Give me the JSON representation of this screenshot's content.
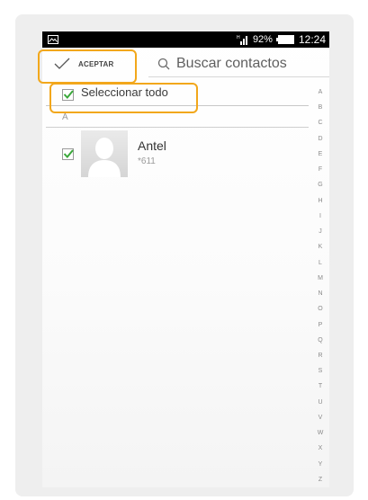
{
  "status_bar": {
    "battery_percent": "92%",
    "time": "12:24"
  },
  "action_bar": {
    "accept_label": "ACEPTAR",
    "search_placeholder": "Buscar contactos"
  },
  "select_all": {
    "label": "Seleccionar todo",
    "checked": true
  },
  "sections": [
    {
      "header": "A",
      "contacts": [
        {
          "name": "Antel",
          "number": "*611",
          "checked": true
        }
      ]
    }
  ],
  "alphabet_index": [
    "A",
    "B",
    "C",
    "D",
    "E",
    "F",
    "G",
    "H",
    "I",
    "J",
    "K",
    "L",
    "M",
    "N",
    "O",
    "P",
    "Q",
    "R",
    "S",
    "T",
    "U",
    "V",
    "W",
    "X",
    "Y",
    "Z"
  ],
  "colors": {
    "highlight": "#f2a71b",
    "checkmark": "#3aa83a",
    "status_bar": "#000000"
  },
  "icons": {
    "status_left": "image-icon",
    "signal": "signal-icon",
    "battery": "battery-icon",
    "accept": "checkmark-icon",
    "search": "search-icon",
    "avatar": "person-silhouette-icon"
  }
}
